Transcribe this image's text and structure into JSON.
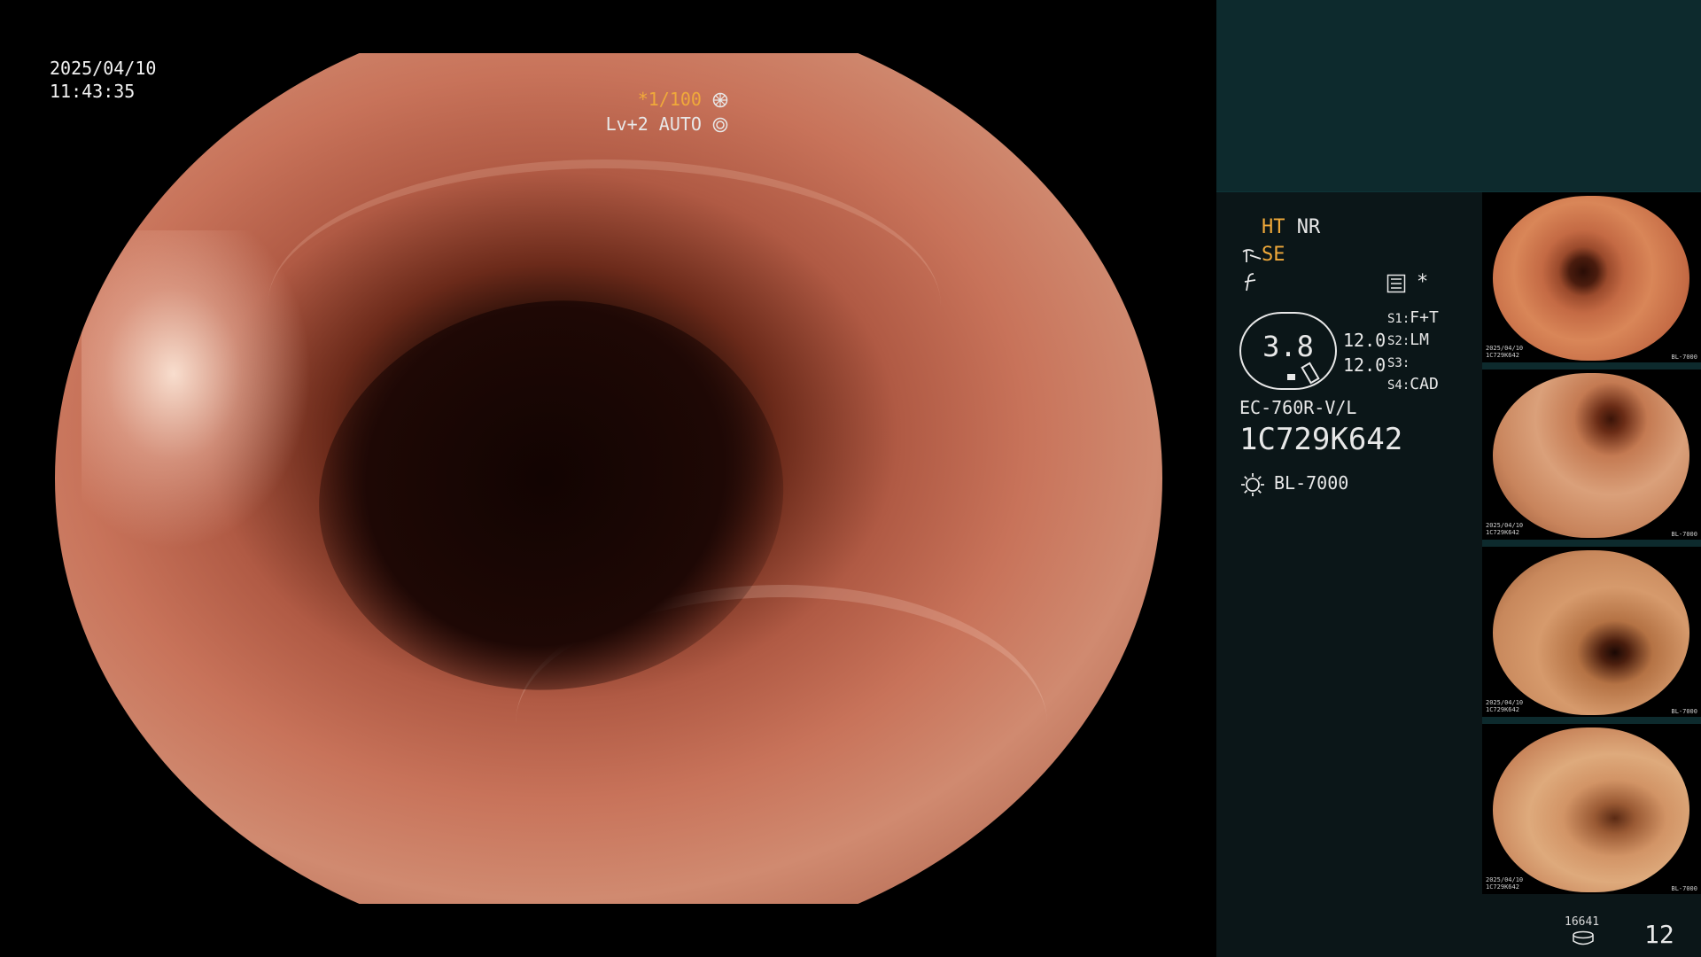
{
  "overlay": {
    "date": "2025/04/10",
    "time": "11:43:35",
    "shutter": "*1/100",
    "level": "Lv+2 AUTO"
  },
  "panel": {
    "ht": "HT",
    "nr": "NR",
    "se": "SE",
    "star": "*",
    "gauge_value": "3.8",
    "gauge_right_1": "12.0",
    "gauge_right_2": "12.0",
    "s1": "S1:",
    "s1_val": "F+T",
    "s2": "S2:",
    "s2_val": "LM",
    "s3": "S3:",
    "s3_val": "",
    "s4": "S4:",
    "s4_val": "CAD",
    "scope_model": "EC-760R-V/L",
    "scope_serial": "1C729K642",
    "light_source": "BL-7000",
    "storage_count": "16641",
    "image_count": "12"
  },
  "thumbnails": [
    {
      "stamp_top": "2025/04/10",
      "stamp_id": "1C729K642",
      "stamp_r": "BL-7000"
    },
    {
      "stamp_top": "2025/04/10",
      "stamp_id": "1C729K642",
      "stamp_r": "BL-7000"
    },
    {
      "stamp_top": "2025/04/10",
      "stamp_id": "1C729K642",
      "stamp_r": "BL-7000"
    },
    {
      "stamp_top": "2025/04/10",
      "stamp_id": "1C729K642",
      "stamp_r": "BL-7000"
    }
  ],
  "icons": [
    "shutter-dial-icon",
    "auto-iris-icon",
    "enhance-icon",
    "freeze-icon",
    "menu-icon",
    "lamp-icon",
    "storage-icon"
  ]
}
